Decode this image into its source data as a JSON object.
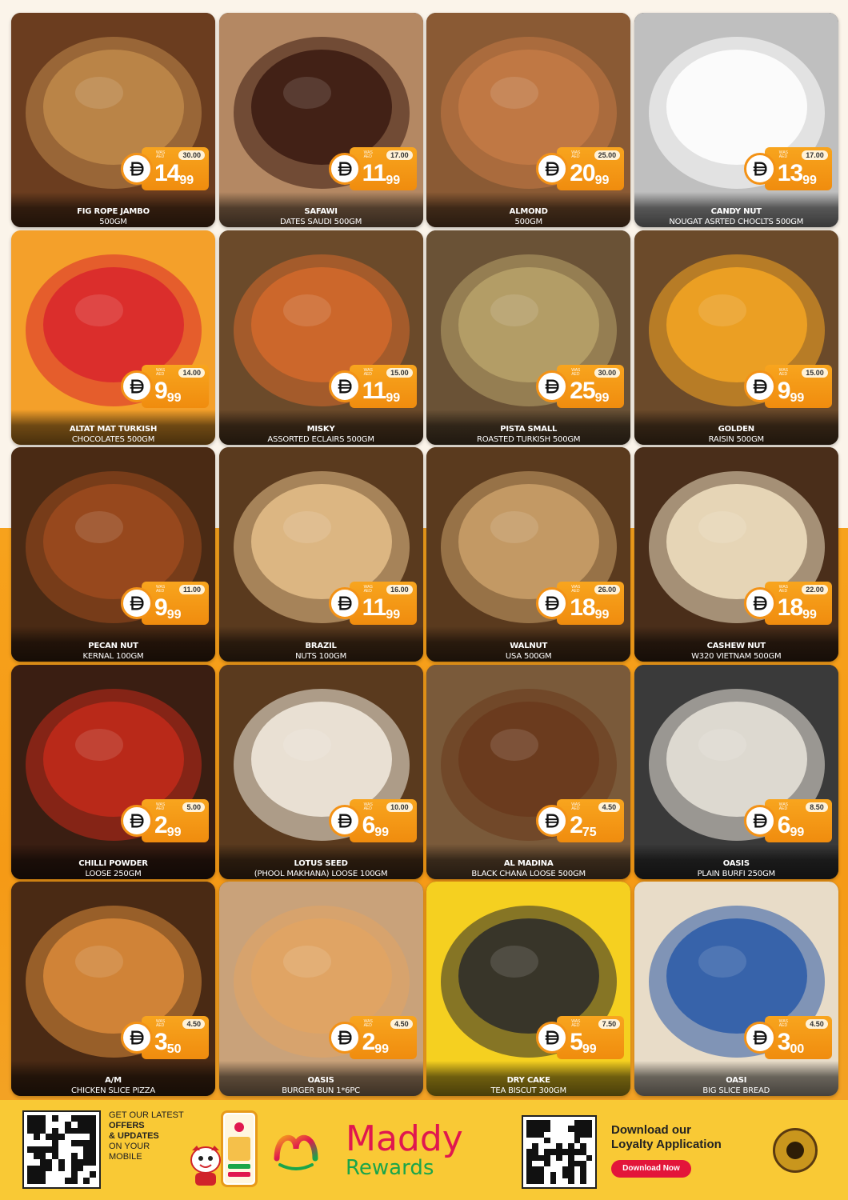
{
  "products": [
    {
      "name": "FIG ROPE JAMBO",
      "size": "500GM",
      "was": "30.00",
      "price_int": "14",
      "price_dec": "99",
      "photo": "fig-rope",
      "colors": [
        "#6b3d1f",
        "#c0894a"
      ]
    },
    {
      "name": "SAFAWI",
      "size": "DATES SAUDI 500GM",
      "was": "17.00",
      "price_int": "11",
      "price_dec": "99",
      "photo": "dates",
      "colors": [
        "#b48863",
        "#3a1a10"
      ]
    },
    {
      "name": "ALMOND",
      "size": "500GM",
      "was": "25.00",
      "price_int": "20",
      "price_dec": "99",
      "photo": "almond",
      "colors": [
        "#8a5a34",
        "#c47a45"
      ]
    },
    {
      "name": "CANDY NUT",
      "size": "NOUGAT ASRTED CHOCLTS 500GM",
      "was": "17.00",
      "price_int": "13",
      "price_dec": "99",
      "photo": "candy-bowl",
      "colors": [
        "#bfbfbf",
        "#ffffff"
      ]
    },
    {
      "name": "ALTAT MAT TURKISH",
      "size": "CHOCOLATES 500GM",
      "was": "14.00",
      "price_int": "9",
      "price_dec": "99",
      "photo": "turkish-chocolates",
      "colors": [
        "#f4a02a",
        "#d9262d"
      ]
    },
    {
      "name": "MISKY",
      "size": "ASSORTED ECLAIRS 500GM",
      "was": "15.00",
      "price_int": "11",
      "price_dec": "99",
      "photo": "eclairs",
      "colors": [
        "#6b4a2a",
        "#d46a2c"
      ]
    },
    {
      "name": "PISTA SMALL",
      "size": "ROASTED TURKISH 500GM",
      "was": "30.00",
      "price_int": "25",
      "price_dec": "99",
      "photo": "pistachio",
      "colors": [
        "#6a5236",
        "#b8a26a"
      ]
    },
    {
      "name": "GOLDEN",
      "size": "RAISIN 500GM",
      "was": "15.00",
      "price_int": "9",
      "price_dec": "99",
      "photo": "raisin",
      "colors": [
        "#6b4a2a",
        "#f5a623"
      ]
    },
    {
      "name": "PECAN NUT",
      "size": "KERNAL 100GM",
      "was": "11.00",
      "price_int": "9",
      "price_dec": "99",
      "photo": "pecan",
      "colors": [
        "#4a2a14",
        "#9c4a1e"
      ]
    },
    {
      "name": "BRAZIL",
      "size": "NUTS 100GM",
      "was": "16.00",
      "price_int": "11",
      "price_dec": "99",
      "photo": "brazil-nut",
      "colors": [
        "#5a3a1e",
        "#e5c08a"
      ]
    },
    {
      "name": "WALNUT",
      "size": "USA 500GM",
      "was": "26.00",
      "price_int": "18",
      "price_dec": "99",
      "photo": "walnut",
      "colors": [
        "#5a3a1e",
        "#caa06a"
      ]
    },
    {
      "name": "CASHEW NUT",
      "size": "W320 VIETNAM 500GM",
      "was": "22.00",
      "price_int": "18",
      "price_dec": "99",
      "photo": "cashew",
      "colors": [
        "#4a2e1a",
        "#f1e2c2"
      ]
    },
    {
      "name": "CHILLI POWDER",
      "size": "LOOSE 250GM",
      "was": "5.00",
      "price_int": "2",
      "price_dec": "99",
      "photo": "chilli-powder",
      "colors": [
        "#3a1e12",
        "#c22a1a"
      ]
    },
    {
      "name": "LOTUS SEED",
      "size": "(PHOOL MAKHANA) LOOSE 100GM",
      "was": "10.00",
      "price_int": "6",
      "price_dec": "99",
      "photo": "makhana",
      "colors": [
        "#5a3a1e",
        "#f3ece0"
      ]
    },
    {
      "name": "AL MADINA",
      "size": "BLACK CHANA LOOSE 500GM",
      "was": "4.50",
      "price_int": "2",
      "price_dec": "75",
      "photo": "black-chana",
      "colors": [
        "#7a5a3a",
        "#6a3a1c"
      ]
    },
    {
      "name": "OASIS",
      "size": "PLAIN BURFI 250GM",
      "was": "8.50",
      "price_int": "6",
      "price_dec": "99",
      "photo": "burfi",
      "colors": [
        "#3a3a3a",
        "#e9e4da"
      ]
    },
    {
      "name": "A/M",
      "size": "CHICKEN SLICE PIZZA",
      "was": "4.50",
      "price_int": "3",
      "price_dec": "50",
      "photo": "pizza",
      "colors": [
        "#4a2a14",
        "#d98a3a"
      ]
    },
    {
      "name": "OASIS",
      "size": "BURGER BUN 1*6PC",
      "was": "4.50",
      "price_int": "2",
      "price_dec": "99",
      "photo": "burger-bun",
      "colors": [
        "#c9a27a",
        "#e2a463"
      ]
    },
    {
      "name": "DRY CAKE",
      "size": "TEA BISCUT 300GM",
      "was": "7.50",
      "price_int": "5",
      "price_dec": "99",
      "photo": "dry-cake",
      "colors": [
        "#f5d020",
        "#2a2a2a"
      ]
    },
    {
      "name": "OASI",
      "size": "BIG SLICE BREAD",
      "was": "4.50",
      "price_int": "3",
      "price_dec": "00",
      "photo": "sliced-bread",
      "colors": [
        "#e8dcc8",
        "#2a5aa8"
      ]
    }
  ],
  "price_tag": {
    "currency_icon": "dirham-icon",
    "was_label": "WAS AED"
  },
  "footer": {
    "offers_lines": [
      "GET OUR LATEST",
      "OFFERS",
      "& UPDATES",
      "ON YOUR",
      "MOBILE"
    ],
    "brand_top": "Maddy",
    "brand_bottom": "Rewards",
    "download_line1": "Download our",
    "download_line2": "Loyalty Application",
    "download_button": "Download Now"
  },
  "theme": {
    "accent": "#f39216",
    "footer_bg": "#f9c935",
    "brand_red": "#e0174f",
    "brand_green": "#1aa54a"
  }
}
